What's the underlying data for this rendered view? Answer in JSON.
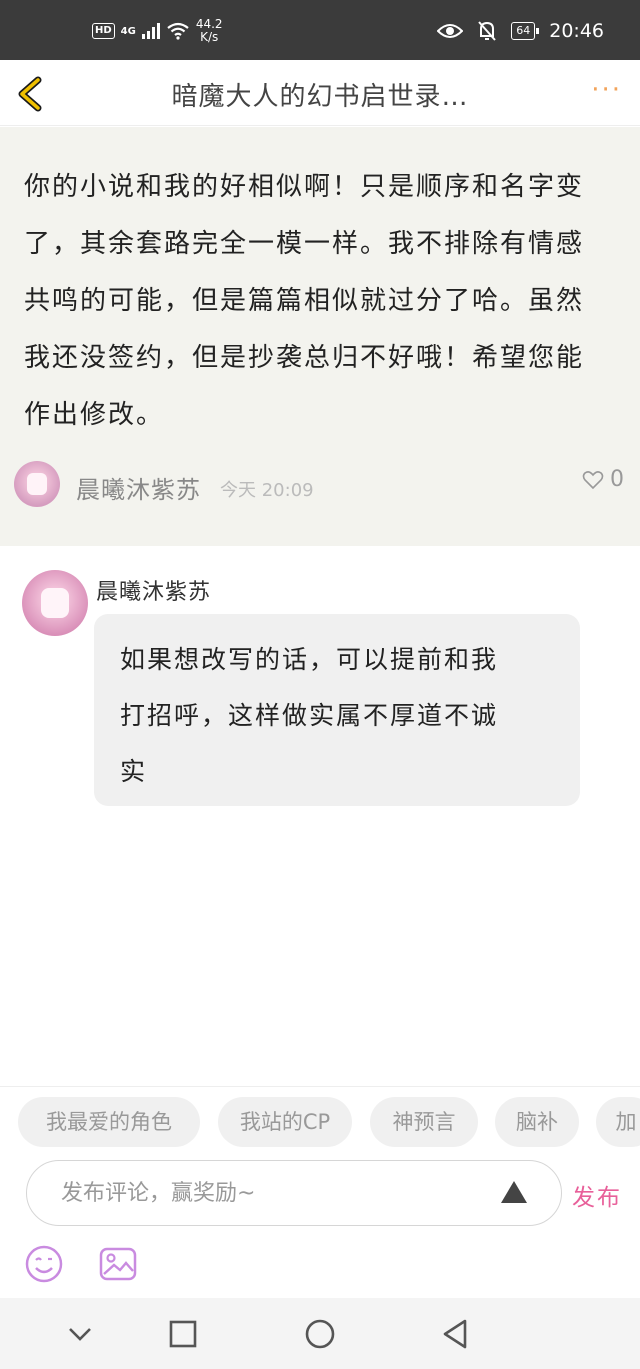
{
  "status_bar": {
    "hd": "HD",
    "network": "4G",
    "speed_value": "44.2",
    "speed_unit": "K/s",
    "battery": "64",
    "time": "20:46",
    "icons": [
      "eye-icon",
      "bell-muted-icon",
      "battery-icon"
    ]
  },
  "header": {
    "title": "暗魔大人的幻书启世录…",
    "more": "···"
  },
  "post": {
    "lines": [
      "你的小说和我的好相似啊！只是顺序和名字变",
      "了，其余套路完全一模一样。我不排除有情感",
      "共鸣的可能，但是篇篇相似就过分了哈。虽然",
      "我还没签约，但是抄袭总归不好哦！希望您能",
      "作出修改。"
    ],
    "author": "晨曦沐紫苏",
    "time": "今天 20:09",
    "likes": "0"
  },
  "reply": {
    "author": "晨曦沐紫苏",
    "lines": [
      "如果想改写的话，可以提前和我",
      "打招呼，这样做实属不厚道不诚",
      "实"
    ]
  },
  "tags": [
    "我最爱的角色",
    "我站的CP",
    "神预言",
    "脑补",
    "加"
  ],
  "comment": {
    "placeholder": "发布评论，赢奖励~",
    "publish": "发布"
  },
  "colors": {
    "accent": "#e8609a",
    "back_arrow": "#f0c000",
    "more": "#f2a35a",
    "post_bg": "#f3f3ee"
  }
}
